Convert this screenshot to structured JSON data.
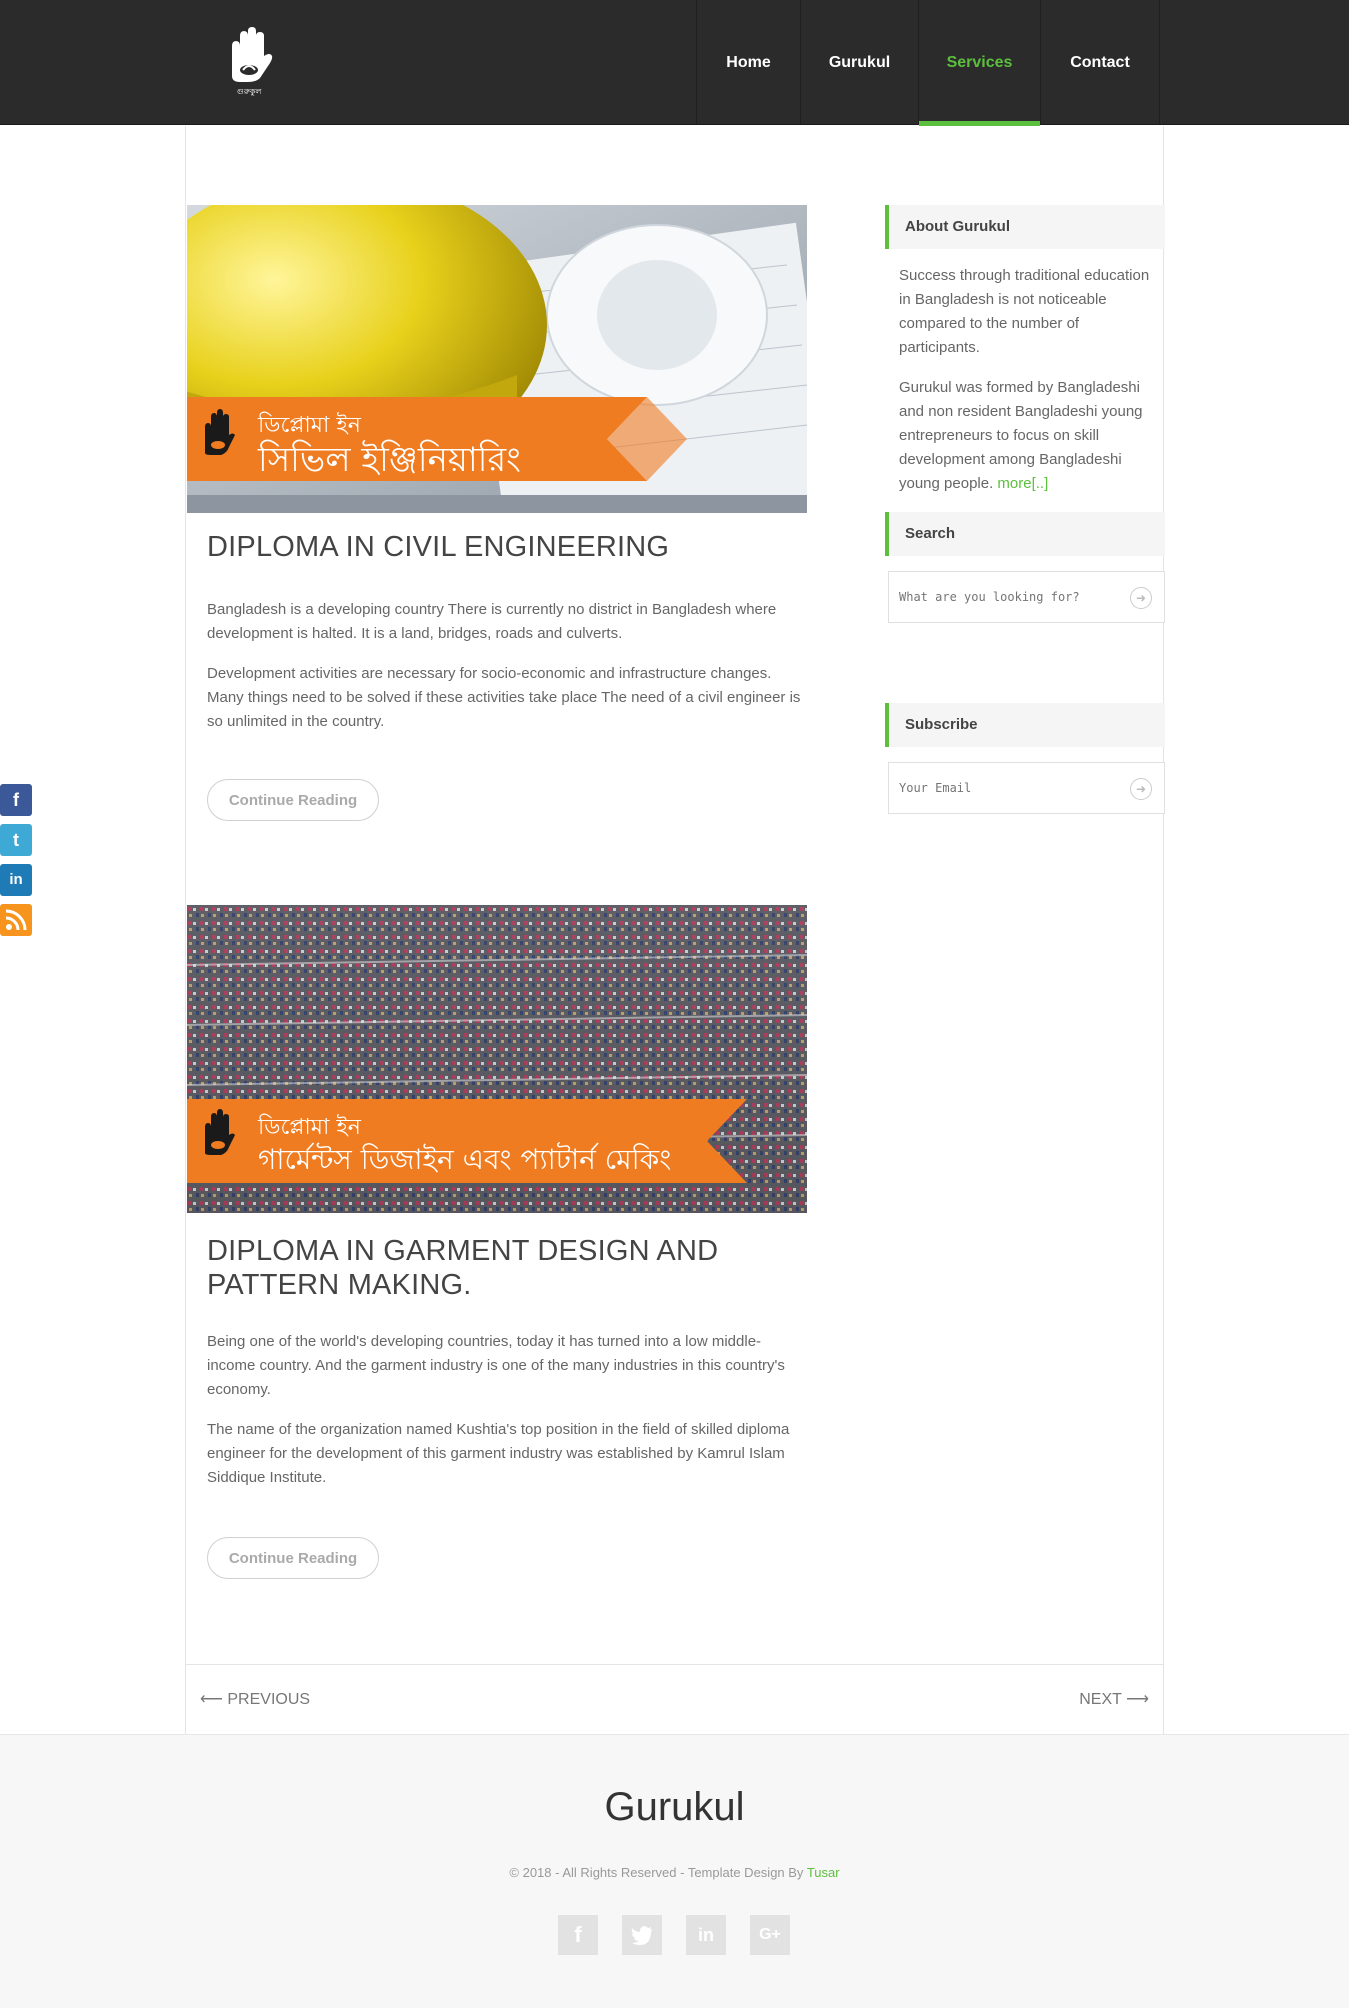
{
  "nav": {
    "items": [
      {
        "label": "Home"
      },
      {
        "label": "Gurukul"
      },
      {
        "label": "Services"
      },
      {
        "label": "Contact"
      }
    ],
    "active": "Services"
  },
  "posts": [
    {
      "banner_small": "ডিপ্লোমা ইন",
      "banner_large": "সিভিল ইঞ্জিনিয়ারিং",
      "title": "DIPLOMA IN CIVIL ENGINEERING",
      "paragraphs": [
        "Bangladesh is a developing country There is currently no district in Bangladesh where development is halted. It is a land, bridges, roads and culverts.",
        "Development activities are necessary for socio-economic and infrastructure changes. Many things need to be solved if these activities take place The need of a civil engineer is so unlimited in the country."
      ],
      "button": "Continue Reading"
    },
    {
      "banner_small": "ডিপ্লোমা ইন",
      "banner_large": "গার্মেন্টস ডিজাইন এবং প্যাটার্ন মেকিং",
      "title_line1": "DIPLOMA IN GARMENT DESIGN AND",
      "title_line2": "PATTERN MAKING.",
      "paragraphs": [
        "Being one of the world's developing countries, today it has turned into a low middle-income country. And the garment industry is one of the many industries in this country's economy.",
        "The name of the organization named Kushtia's top position in the field of skilled diploma engineer for the development of this garment industry was established by Kamrul Islam Siddique Institute."
      ],
      "button": "Continue Reading"
    }
  ],
  "sidebar": {
    "about_title": "About Gurukul",
    "about_p1": "Success through traditional education in Bangladesh is not noticeable compared to the number of participants.",
    "about_p2": "Gurukul was formed by Bangladeshi and non resident Bangladeshi young entrepreneurs to focus on skill development among Bangladeshi young people.",
    "about_more": "more[..]",
    "search_title": "Search",
    "search_placeholder": "What are you looking for?",
    "subscribe_title": "Subscribe",
    "subscribe_placeholder": "Your Email"
  },
  "pager": {
    "prev": "⟵ PREVIOUS",
    "next": "NEXT ⟶"
  },
  "footer": {
    "title": "Gurukul",
    "copyright": "© 2018 - All Rights Reserved - Template Design By",
    "author": "Tusar"
  },
  "colors": {
    "accent": "#5cbf3d",
    "header_bg": "#2b2b2b",
    "banner_orange": "#f07c22"
  }
}
